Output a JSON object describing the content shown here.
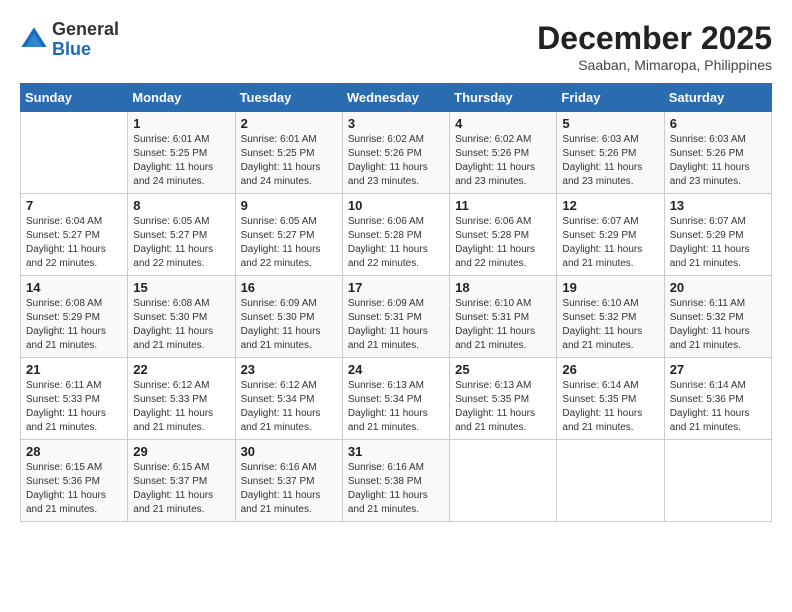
{
  "header": {
    "logo_general": "General",
    "logo_blue": "Blue",
    "month": "December 2025",
    "location": "Saaban, Mimaropa, Philippines"
  },
  "weekdays": [
    "Sunday",
    "Monday",
    "Tuesday",
    "Wednesday",
    "Thursday",
    "Friday",
    "Saturday"
  ],
  "weeks": [
    [
      {
        "day": "",
        "sunrise": "",
        "sunset": "",
        "daylight": ""
      },
      {
        "day": "1",
        "sunrise": "6:01 AM",
        "sunset": "5:25 PM",
        "daylight": "11 hours and 24 minutes."
      },
      {
        "day": "2",
        "sunrise": "6:01 AM",
        "sunset": "5:25 PM",
        "daylight": "11 hours and 24 minutes."
      },
      {
        "day": "3",
        "sunrise": "6:02 AM",
        "sunset": "5:26 PM",
        "daylight": "11 hours and 23 minutes."
      },
      {
        "day": "4",
        "sunrise": "6:02 AM",
        "sunset": "5:26 PM",
        "daylight": "11 hours and 23 minutes."
      },
      {
        "day": "5",
        "sunrise": "6:03 AM",
        "sunset": "5:26 PM",
        "daylight": "11 hours and 23 minutes."
      },
      {
        "day": "6",
        "sunrise": "6:03 AM",
        "sunset": "5:26 PM",
        "daylight": "11 hours and 23 minutes."
      }
    ],
    [
      {
        "day": "7",
        "sunrise": "6:04 AM",
        "sunset": "5:27 PM",
        "daylight": "11 hours and 22 minutes."
      },
      {
        "day": "8",
        "sunrise": "6:05 AM",
        "sunset": "5:27 PM",
        "daylight": "11 hours and 22 minutes."
      },
      {
        "day": "9",
        "sunrise": "6:05 AM",
        "sunset": "5:27 PM",
        "daylight": "11 hours and 22 minutes."
      },
      {
        "day": "10",
        "sunrise": "6:06 AM",
        "sunset": "5:28 PM",
        "daylight": "11 hours and 22 minutes."
      },
      {
        "day": "11",
        "sunrise": "6:06 AM",
        "sunset": "5:28 PM",
        "daylight": "11 hours and 22 minutes."
      },
      {
        "day": "12",
        "sunrise": "6:07 AM",
        "sunset": "5:29 PM",
        "daylight": "11 hours and 21 minutes."
      },
      {
        "day": "13",
        "sunrise": "6:07 AM",
        "sunset": "5:29 PM",
        "daylight": "11 hours and 21 minutes."
      }
    ],
    [
      {
        "day": "14",
        "sunrise": "6:08 AM",
        "sunset": "5:29 PM",
        "daylight": "11 hours and 21 minutes."
      },
      {
        "day": "15",
        "sunrise": "6:08 AM",
        "sunset": "5:30 PM",
        "daylight": "11 hours and 21 minutes."
      },
      {
        "day": "16",
        "sunrise": "6:09 AM",
        "sunset": "5:30 PM",
        "daylight": "11 hours and 21 minutes."
      },
      {
        "day": "17",
        "sunrise": "6:09 AM",
        "sunset": "5:31 PM",
        "daylight": "11 hours and 21 minutes."
      },
      {
        "day": "18",
        "sunrise": "6:10 AM",
        "sunset": "5:31 PM",
        "daylight": "11 hours and 21 minutes."
      },
      {
        "day": "19",
        "sunrise": "6:10 AM",
        "sunset": "5:32 PM",
        "daylight": "11 hours and 21 minutes."
      },
      {
        "day": "20",
        "sunrise": "6:11 AM",
        "sunset": "5:32 PM",
        "daylight": "11 hours and 21 minutes."
      }
    ],
    [
      {
        "day": "21",
        "sunrise": "6:11 AM",
        "sunset": "5:33 PM",
        "daylight": "11 hours and 21 minutes."
      },
      {
        "day": "22",
        "sunrise": "6:12 AM",
        "sunset": "5:33 PM",
        "daylight": "11 hours and 21 minutes."
      },
      {
        "day": "23",
        "sunrise": "6:12 AM",
        "sunset": "5:34 PM",
        "daylight": "11 hours and 21 minutes."
      },
      {
        "day": "24",
        "sunrise": "6:13 AM",
        "sunset": "5:34 PM",
        "daylight": "11 hours and 21 minutes."
      },
      {
        "day": "25",
        "sunrise": "6:13 AM",
        "sunset": "5:35 PM",
        "daylight": "11 hours and 21 minutes."
      },
      {
        "day": "26",
        "sunrise": "6:14 AM",
        "sunset": "5:35 PM",
        "daylight": "11 hours and 21 minutes."
      },
      {
        "day": "27",
        "sunrise": "6:14 AM",
        "sunset": "5:36 PM",
        "daylight": "11 hours and 21 minutes."
      }
    ],
    [
      {
        "day": "28",
        "sunrise": "6:15 AM",
        "sunset": "5:36 PM",
        "daylight": "11 hours and 21 minutes."
      },
      {
        "day": "29",
        "sunrise": "6:15 AM",
        "sunset": "5:37 PM",
        "daylight": "11 hours and 21 minutes."
      },
      {
        "day": "30",
        "sunrise": "6:16 AM",
        "sunset": "5:37 PM",
        "daylight": "11 hours and 21 minutes."
      },
      {
        "day": "31",
        "sunrise": "6:16 AM",
        "sunset": "5:38 PM",
        "daylight": "11 hours and 21 minutes."
      },
      {
        "day": "",
        "sunrise": "",
        "sunset": "",
        "daylight": ""
      },
      {
        "day": "",
        "sunrise": "",
        "sunset": "",
        "daylight": ""
      },
      {
        "day": "",
        "sunrise": "",
        "sunset": "",
        "daylight": ""
      }
    ]
  ]
}
